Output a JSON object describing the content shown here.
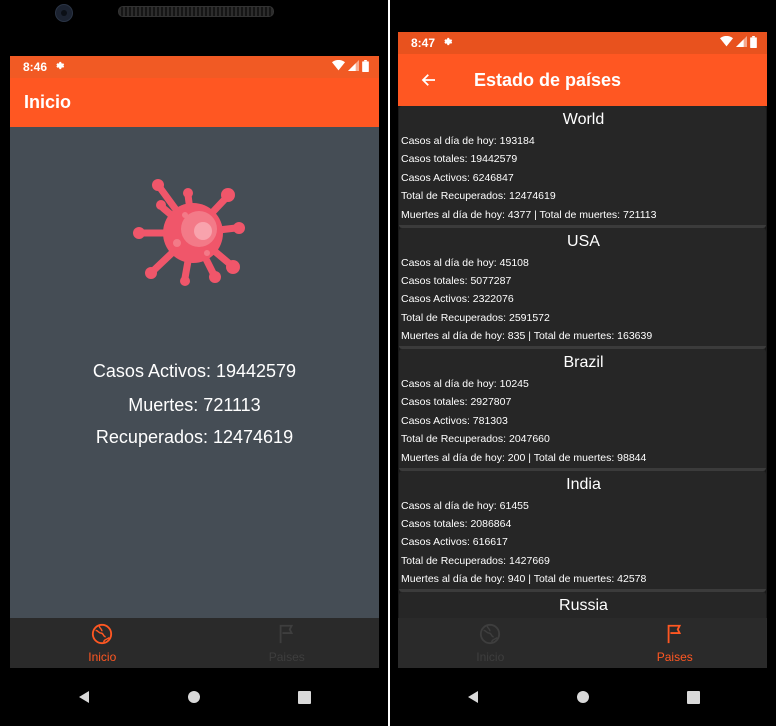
{
  "home": {
    "status_time": "8:46",
    "appbar_title": "Inicio",
    "stats": {
      "active": "Casos Activos: 19442579",
      "deaths": "Muertes: 721113",
      "recovered": "Recuperados: 12474619"
    },
    "nav": {
      "home_label": "Inicio",
      "countries_label": "Paises"
    }
  },
  "countries": {
    "status_time": "8:47",
    "appbar_title": "Estado de países",
    "nav": {
      "home_label": "Inicio",
      "countries_label": "Paises"
    },
    "items": [
      {
        "name": "World",
        "today_cases": "Casos al día de hoy: 193184",
        "total_cases": "Casos totales: 19442579",
        "active_cases": "Casos Activos: 6246847",
        "recovered": "Total de Recuperados: 12474619",
        "deaths": "Muertes al día de hoy: 4377 | Total de muertes: 721113"
      },
      {
        "name": "USA",
        "today_cases": "Casos al día de hoy: 45108",
        "total_cases": "Casos totales: 5077287",
        "active_cases": "Casos Activos: 2322076",
        "recovered": "Total de Recuperados: 2591572",
        "deaths": "Muertes al día de hoy: 835 | Total de muertes: 163639"
      },
      {
        "name": "Brazil",
        "today_cases": "Casos al día de hoy: 10245",
        "total_cases": "Casos totales: 2927807",
        "active_cases": "Casos Activos: 781303",
        "recovered": "Total de Recuperados: 2047660",
        "deaths": "Muertes al día de hoy: 200 | Total de muertes: 98844"
      },
      {
        "name": "India",
        "today_cases": "Casos al día de hoy: 61455",
        "total_cases": "Casos totales: 2086864",
        "active_cases": "Casos Activos: 616617",
        "recovered": "Total de Recuperados: 1427669",
        "deaths": "Muertes al día de hoy: 940 | Total de muertes: 42578"
      },
      {
        "name": "Russia"
      }
    ]
  },
  "colors": {
    "accent": "#ff5722",
    "statusbar": "#f15a24",
    "home_bg": "#454d55",
    "list_bg": "#1a1a1a",
    "card_bg": "#262626",
    "virus": "#f0566a"
  },
  "icons": [
    "settings-icon",
    "wifi-icon",
    "signal-icon",
    "battery-icon",
    "back-arrow-icon",
    "virus-icon",
    "globe-icon",
    "flag-icon",
    "nav-back-icon",
    "nav-home-icon",
    "nav-recents-icon"
  ]
}
